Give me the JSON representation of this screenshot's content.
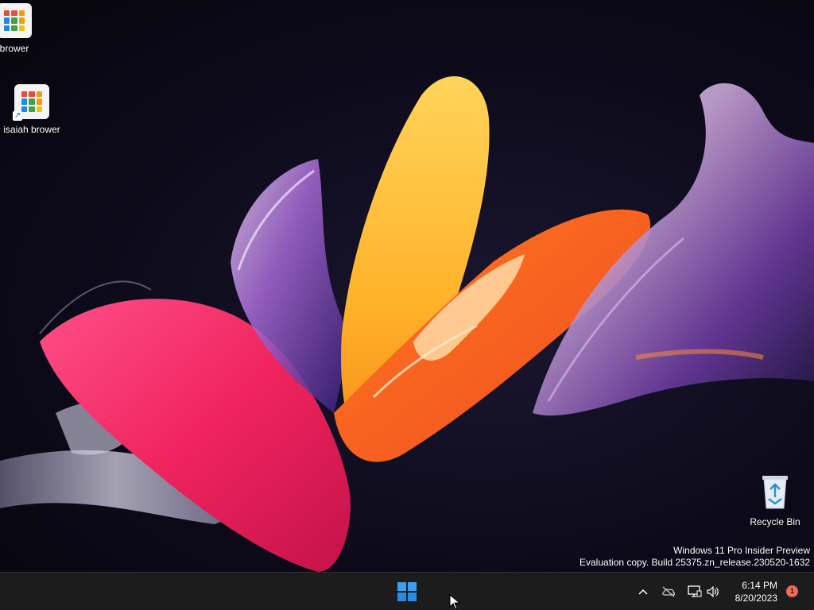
{
  "desktop": {
    "icons": [
      {
        "label": "brower",
        "name": "desktop-icon-brower"
      },
      {
        "label": "isaiah brower",
        "name": "desktop-icon-isaiah-brower"
      },
      {
        "label": "Recycle Bin",
        "name": "desktop-icon-recycle-bin"
      }
    ],
    "watermark": {
      "line1": "Windows 11 Pro Insider Preview",
      "line2": "Evaluation copy. Build 25375.zn_release.230520-1632"
    }
  },
  "taskbar": {
    "start_icon": "windows-logo-icon",
    "tray": {
      "chevron_icon": "chevron-up-icon",
      "cloud_icon": "onedrive-offline-icon",
      "network_icon": "network-icon",
      "volume_icon": "speaker-icon"
    },
    "clock": {
      "time": "6:14 PM",
      "date": "8/20/2023"
    },
    "notification_count": "1"
  },
  "colors": {
    "taskbar_bg": "#1c1c1c",
    "start_blue": "#3aa0f0",
    "badge": "#f06a55"
  }
}
